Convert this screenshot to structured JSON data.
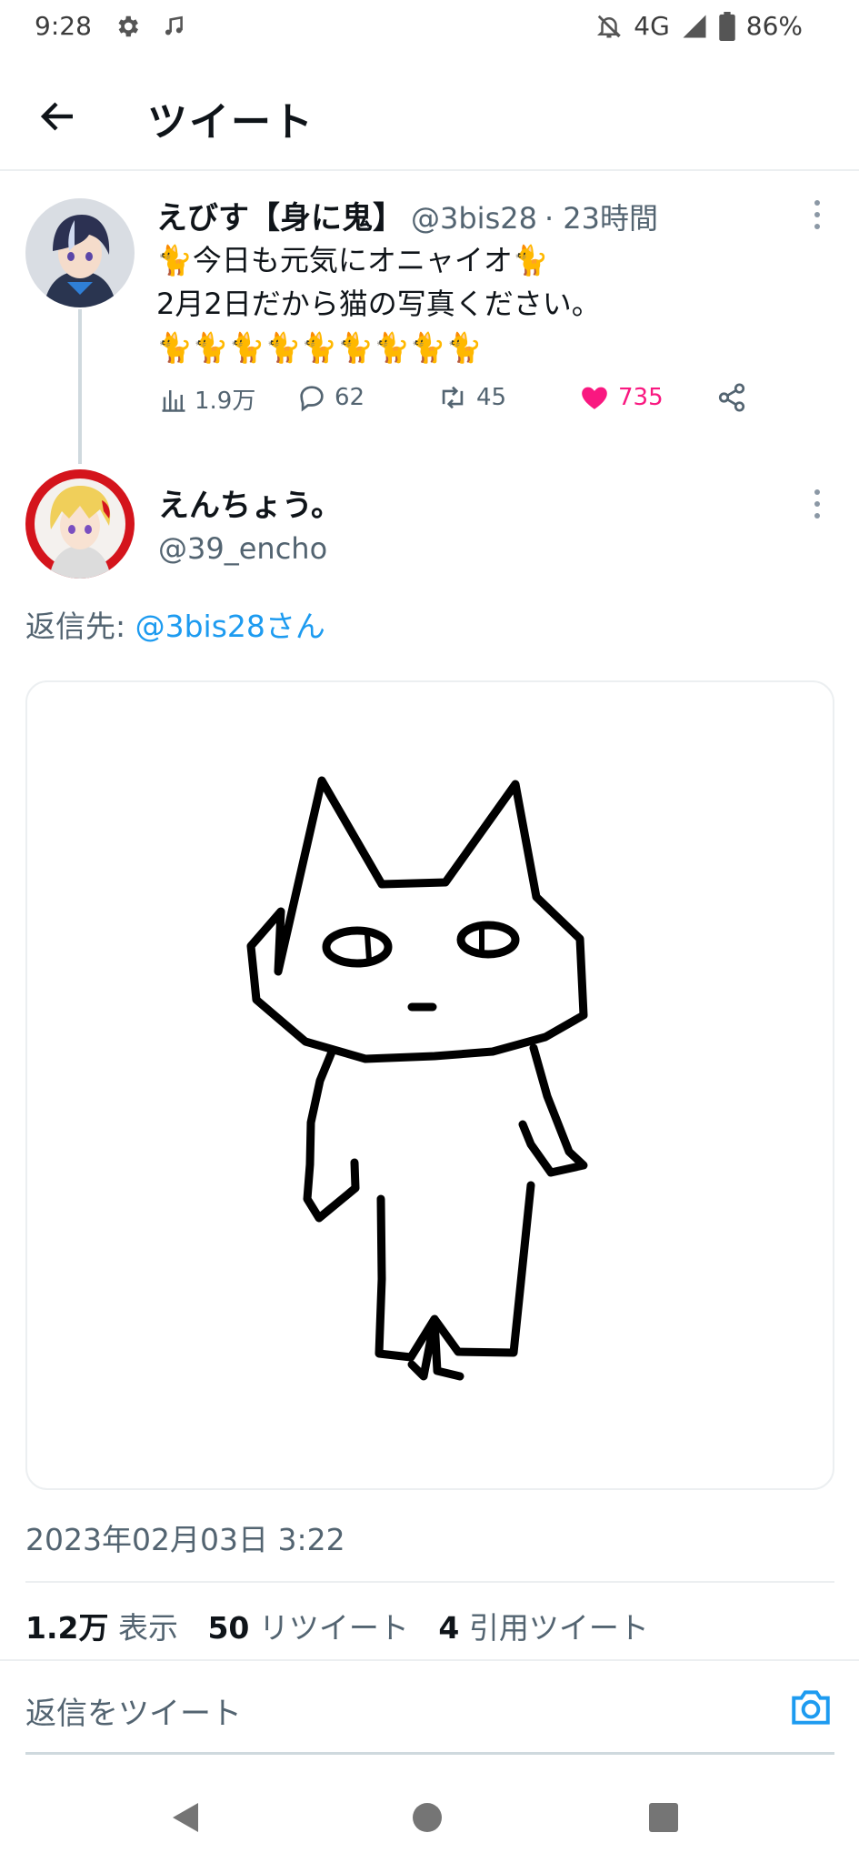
{
  "status_bar": {
    "time": "9:28",
    "network": "4G",
    "battery": "86%",
    "icons": [
      "gear-icon",
      "music-note-icon",
      "notifications-off-icon",
      "signal-icon",
      "battery-icon"
    ]
  },
  "header": {
    "title": "ツイート",
    "back_icon": "arrow-left-icon"
  },
  "parent_tweet": {
    "display_name": "えびす【身に鬼】",
    "handle": "@3bis28",
    "time": "· 23時間",
    "line1": "🐈今日も元気にオニャイオ🐈",
    "line2": "2月2日だから猫の写真ください。",
    "line3": "🐈🐈🐈🐈🐈🐈🐈🐈🐈",
    "views": "1.9万",
    "replies": "62",
    "retweets": "45",
    "likes": "735"
  },
  "main_tweet": {
    "display_name": "えんちょう。",
    "handle": "@39_encho",
    "reply_to_label": "返信先: ",
    "reply_to_mention": "@3bis28さん",
    "datetime": "2023年02月03日 3:22",
    "stats": {
      "views_count": "1.2万",
      "views_label": "表示",
      "retweets_count": "50",
      "retweets_label": "リツイート",
      "quotes_count": "4",
      "quotes_label": "引用ツイート"
    }
  },
  "reply_bar": {
    "placeholder": "返信をツイート"
  },
  "colors": {
    "like": "#f91880",
    "link": "#1d9bf0",
    "text_secondary": "#536471",
    "divider": "#eceff1"
  }
}
